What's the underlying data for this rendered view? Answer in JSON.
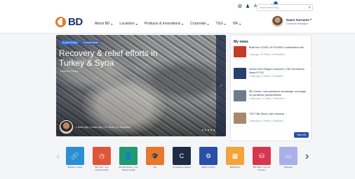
{
  "header": {
    "logo": "BD",
    "search_placeholder": "Start searching...",
    "notification_count": "1",
    "nav": [
      {
        "label": "About BD"
      },
      {
        "label": "Locations"
      },
      {
        "label": "Products & Innovations"
      },
      {
        "label": "Corporate"
      },
      {
        "label": "TGS"
      },
      {
        "label": "HR"
      }
    ],
    "user": {
      "name": "Name Surname",
      "role": "Content Manager"
    }
  },
  "hero": {
    "tags": [
      "Social Giving",
      "Product News"
    ],
    "title": "Recovery & relief efforts in Turkey & Syria",
    "subtitle": "Relief for Turkey...",
    "meta": "1 week ago | 3 days ago | 20 Views | 10 Reactions"
  },
  "news": {
    "title": "My news",
    "items": [
      {
        "headline": "Build the COVID-19 PH-BNS/ combination kits",
        "time": "1 day ago | 20 Views | 10 Reactions",
        "thumb_color": "#c43b2a"
      },
      {
        "headline": "Veritor 2022 Region received 1,782 Excellence Award FY22",
        "time": "2 days ago | 5 Views | 2 Reactions",
        "thumb_color": "#2a3f6b"
      },
      {
        "headline": "BD Center: new pandemic knowledge exchange on pandemic preparedness",
        "time": "3 days ago | 17 Views | 3 Reactions",
        "thumb_color": "#6f7b8c"
      },
      {
        "headline": "TGS Talk Show Latin America",
        "time": "3 days ago | 9 Views | 1 Reactions",
        "thumb_color": "#a58a6c"
      }
    ],
    "view_all": "View All"
  },
  "apps": [
    {
      "label": "Bridges & Tools",
      "color": "#2a8fd6",
      "icon": "link-icon",
      "glyph": "🔗"
    },
    {
      "label": "BD Time - use DayforceHCM",
      "color": "#e0553a",
      "icon": "clock-icon",
      "glyph": "◷"
    },
    {
      "label": "Benefits Direct - use DayforceHCM",
      "color": "#1f9a74",
      "icon": "person-icon",
      "glyph": "👤"
    },
    {
      "label": "LID",
      "color": "#e8762d",
      "icon": "graduation-cap-icon",
      "glyph": "🎓"
    },
    {
      "label": "Consulting Catalyst",
      "color": "#1f2a44",
      "icon": "c-logo-icon",
      "glyph": "C"
    },
    {
      "label": "Ethics & Work",
      "color": "#2a4fa8",
      "icon": "gear-icon",
      "glyph": "⚙"
    },
    {
      "label": "BOB Menu",
      "color": "#f2a43a",
      "icon": "grid-icon",
      "glyph": "▦"
    },
    {
      "label": "BD Sight - use AD Contract",
      "color": "#d8364f",
      "icon": "database-icon",
      "glyph": "⛁"
    },
    {
      "label": "Workday",
      "color": "#a9afe8",
      "icon": "workday-icon",
      "glyph": "▭"
    }
  ]
}
